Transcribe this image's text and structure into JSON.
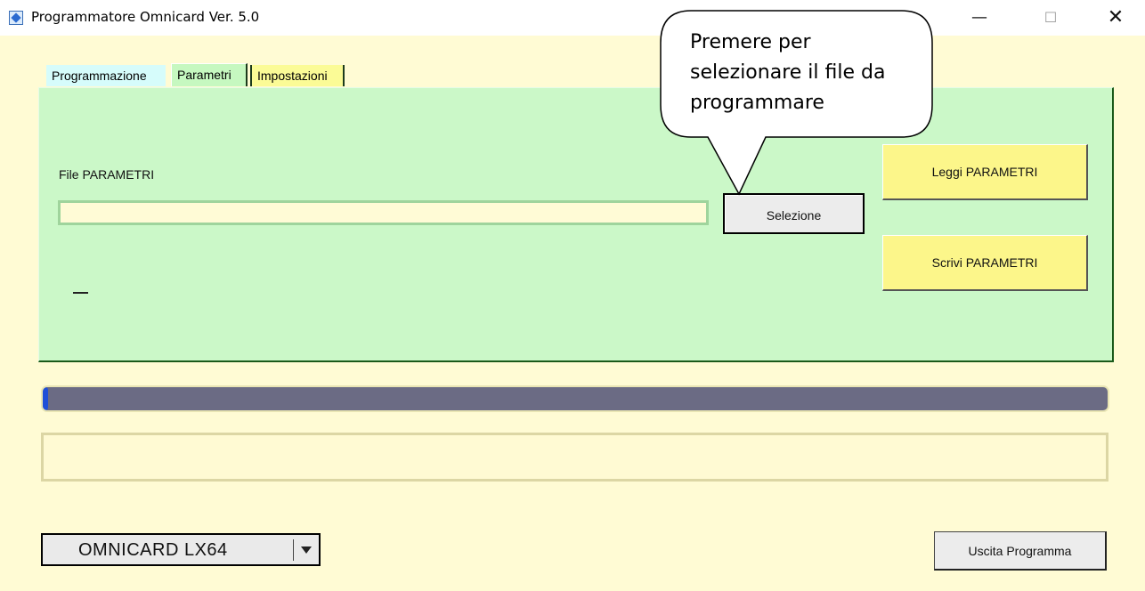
{
  "window": {
    "title": "Programmatore Omnicard Ver. 5.0",
    "controls": [
      "minimize-icon",
      "maximize-icon",
      "close-icon"
    ]
  },
  "tabs": [
    {
      "label": "Programmazione",
      "active": false,
      "color": "#d6fcfb"
    },
    {
      "label": "Parametri",
      "active": true,
      "color": "#c6f8c0"
    },
    {
      "label": "Impostazioni",
      "active": false,
      "color": "#fbfb96"
    }
  ],
  "parametri": {
    "file_label": "File PARAMETRI",
    "file_value": "",
    "select_button": "Selezione",
    "read_button": "Leggi PARAMETRI",
    "write_button": "Scrivi PARAMETRI",
    "status_text": "_"
  },
  "progress": {
    "value": 0.005,
    "color": "#1f4fd8"
  },
  "status_message": "",
  "device_select": {
    "selected": "OMNICARD LX64"
  },
  "exit_button": "Uscita Programma",
  "callout": {
    "lines": [
      "Premere per",
      "selezionare il file da",
      "programmare"
    ]
  },
  "colors": {
    "background": "#fffbd4",
    "panel": "#cbf8c8",
    "action_button": "#fcf68a"
  }
}
